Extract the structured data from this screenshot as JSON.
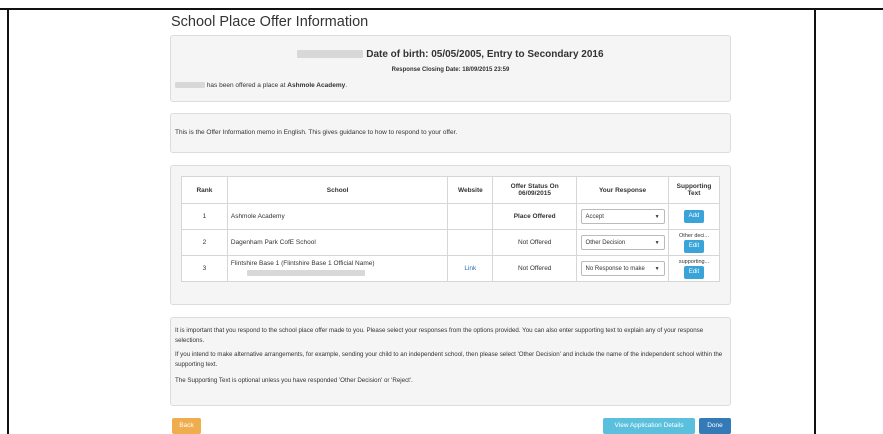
{
  "page": {
    "title": "School Place Offer Information"
  },
  "header": {
    "dob_entry": "Date of birth: 05/05/2005, Entry to Secondary 2016",
    "closing_date": "Response Closing Date: 18/09/2015 23:59",
    "offer_prefix": "has been offered a place at",
    "offer_school": "Ashmole Academy",
    "offer_suffix": "."
  },
  "memo": {
    "text": "This is the Offer Information memo in English.  This gives guidance to how to respond to your offer."
  },
  "table": {
    "headers": {
      "rank": "Rank",
      "school": "School",
      "website": "Website",
      "status": "Offer Status On 06/09/2015",
      "response": "Your Response",
      "supporting": "Supporting Text"
    },
    "rows": [
      {
        "rank": "1",
        "school": "Ashmole Academy",
        "website": "",
        "status": "Place Offered",
        "response": "Accept",
        "supporting_text": "",
        "supporting_button": "Add"
      },
      {
        "rank": "2",
        "school": "Dagenham Park CofE School",
        "website": "",
        "status": "Not Offered",
        "response": "Other Decision",
        "supporting_text": "Other deci...",
        "supporting_button": "Edit"
      },
      {
        "rank": "3",
        "school": "Flintshire Base 1 (Flintshire Base 1 Official Name)",
        "website": "Link",
        "status": "Not Offered",
        "response": "No Response to make",
        "supporting_text": "supporting...",
        "supporting_button": "Edit"
      }
    ]
  },
  "notes": {
    "n1": "It is important that you respond to the school place offer made to you. Please select your responses from the options provided. You can also enter supporting text to explain any of your response selections.",
    "n2": "If you intend to make alternative arrangements, for example, sending your child to an independent school, then please select 'Other Decision' and include the name of the independent school within the supporting text.",
    "n3": "The Supporting Text is optional unless you have responded 'Other Decision' or 'Reject'."
  },
  "buttons": {
    "back": "Back",
    "view": "View Application Details",
    "done": "Done"
  },
  "colors": {
    "back": "#f0ad4e",
    "view": "#5bc0de",
    "done": "#337ab7",
    "small_button": "#3aa3d8"
  }
}
